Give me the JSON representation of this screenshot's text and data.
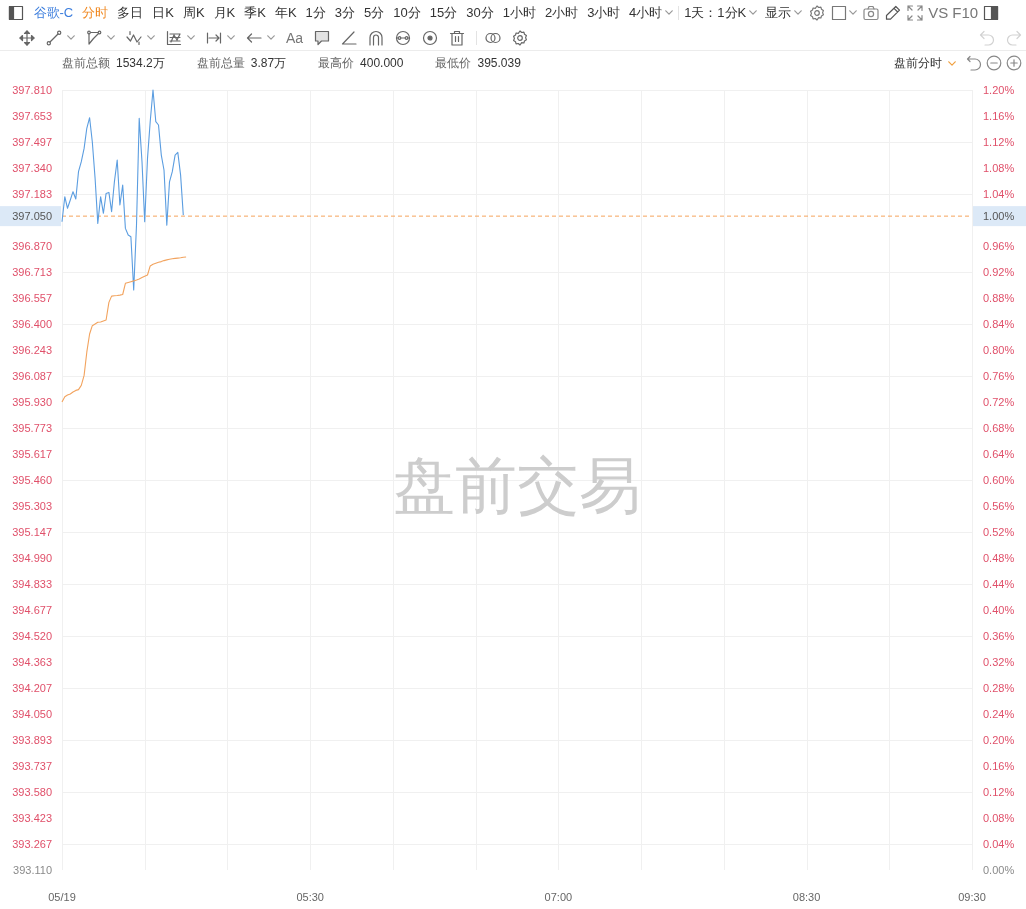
{
  "toolbar": {
    "symbol": "谷歌-C",
    "periods": [
      {
        "label": "分时",
        "selected": true,
        "kind": "tab"
      },
      {
        "label": "多日",
        "selected": false,
        "kind": "tab"
      },
      {
        "label": "日K",
        "selected": false,
        "kind": "tab"
      },
      {
        "label": "周K",
        "selected": false,
        "kind": "tab"
      },
      {
        "label": "月K",
        "selected": false,
        "kind": "tab"
      },
      {
        "label": "季K",
        "selected": false,
        "kind": "tab"
      },
      {
        "label": "年K",
        "selected": false,
        "kind": "tab"
      },
      {
        "label": "1分",
        "selected": false,
        "kind": "tab"
      },
      {
        "label": "3分",
        "selected": false,
        "kind": "tab"
      },
      {
        "label": "5分",
        "selected": false,
        "kind": "tab"
      },
      {
        "label": "10分",
        "selected": false,
        "kind": "tab"
      },
      {
        "label": "15分",
        "selected": false,
        "kind": "tab"
      },
      {
        "label": "30分",
        "selected": false,
        "kind": "tab"
      },
      {
        "label": "1小时",
        "selected": false,
        "kind": "tab"
      },
      {
        "label": "2小时",
        "selected": false,
        "kind": "tab"
      },
      {
        "label": "3小时",
        "selected": false,
        "kind": "tab"
      },
      {
        "label": "4小时",
        "selected": false,
        "kind": "menu"
      }
    ],
    "interval_menu": "1天：1分K",
    "display_menu": "显示",
    "compare": "VS",
    "f10": "F10"
  },
  "drawing_tools": {
    "text_tool": "Aa",
    "undo": {
      "disabled": true
    },
    "redo": {
      "disabled": true
    }
  },
  "stats": [
    {
      "label": "盘前总额",
      "value": "1534.2万"
    },
    {
      "label": "盘前总量",
      "value": "3.87万"
    },
    {
      "label": "最高价",
      "value": "400.000"
    },
    {
      "label": "最低价",
      "value": "395.039"
    }
  ],
  "chart_mode_menu": "盘前分时",
  "chart": {
    "session_label": "盘前交易",
    "chart_data": {
      "type": "line",
      "categories": [
        "05/19",
        null,
        null,
        null,
        null,
        null,
        null,
        null,
        null,
        null,
        null,
        null,
        null,
        null,
        null,
        null,
        null,
        null,
        null,
        null,
        null,
        null,
        null,
        null,
        null,
        null,
        null,
        null,
        null,
        null,
        null,
        null,
        null,
        null,
        null,
        null,
        null,
        null,
        null,
        null,
        null,
        null,
        null,
        null,
        null,
        null,
        null,
        null,
        null,
        null,
        null,
        null,
        null,
        null,
        null,
        null,
        null,
        null,
        null,
        null,
        null,
        null,
        null,
        null,
        null,
        null,
        null,
        null,
        null,
        null,
        null,
        null,
        null,
        null,
        null,
        null,
        null,
        null,
        null,
        null,
        null,
        null,
        null,
        null,
        null,
        null,
        null,
        null,
        null,
        null,
        "05:30",
        null,
        null,
        null,
        null,
        null,
        null,
        null,
        null,
        null,
        null,
        null,
        null,
        null,
        null,
        null,
        null,
        null,
        null,
        null,
        null,
        null,
        null,
        null,
        null,
        null,
        null,
        null,
        null,
        null,
        null,
        null,
        null,
        null,
        null,
        null,
        null,
        null,
        null,
        null,
        null,
        null,
        null,
        null,
        null,
        null,
        null,
        null,
        null,
        null,
        null,
        null,
        null,
        null,
        null,
        null,
        null,
        null,
        null,
        null,
        null,
        null,
        null,
        null,
        null,
        null,
        null,
        null,
        null,
        null,
        null,
        null,
        null,
        null,
        null,
        null,
        null,
        null,
        null,
        null,
        null,
        null,
        null,
        null,
        null,
        null,
        null,
        null,
        null,
        null,
        "07:00",
        null,
        null,
        null,
        null,
        null,
        null,
        null,
        null,
        null,
        null,
        null,
        null,
        null,
        null,
        null,
        null,
        null,
        null,
        null,
        null,
        null,
        null,
        null,
        null,
        null,
        null,
        null,
        null,
        null,
        null,
        null,
        null,
        null,
        null,
        null,
        null,
        null,
        null,
        null,
        null,
        null,
        null,
        null,
        null,
        null,
        null,
        null,
        null,
        null,
        null,
        null,
        null,
        null,
        null,
        null,
        null,
        null,
        null,
        null,
        null,
        null,
        null,
        null,
        null,
        null,
        null,
        null,
        null,
        null,
        null,
        null,
        null,
        null,
        null,
        null,
        null,
        null,
        null,
        null,
        null,
        null,
        null,
        null,
        null,
        null,
        null,
        null,
        null,
        null,
        "08:30",
        null,
        null,
        null,
        null,
        null,
        null,
        null,
        null,
        null,
        null,
        null,
        null,
        null,
        null,
        null,
        null,
        null,
        null,
        null,
        null,
        null,
        null,
        null,
        null,
        null,
        null,
        null,
        null,
        null,
        null,
        null,
        null,
        null,
        null,
        null,
        null,
        null,
        null,
        null,
        null,
        null,
        null,
        null,
        null,
        null,
        null,
        null,
        null,
        null,
        null,
        null,
        null,
        null,
        null,
        null,
        null,
        null,
        null,
        null,
        "09:30"
      ],
      "series": [
        {
          "color": "#5b9de0",
          "values": [
            397.016,
            397.167,
            397.097,
            397.147,
            397.197,
            397.153,
            397.318,
            397.378,
            397.458,
            397.579,
            397.643,
            397.498,
            397.277,
            397.006,
            397.167,
            397.067,
            397.187,
            397.193,
            397.077,
            397.257,
            397.388,
            397.117,
            397.237,
            396.976,
            396.936,
            396.926,
            396.605,
            396.996,
            397.639,
            397.378,
            397.016,
            397.398,
            397.619,
            397.81,
            397.619,
            397.599,
            397.418,
            397.328,
            396.996,
            397.257,
            397.318,
            397.418,
            397.434,
            397.297,
            397.056,
            null,
            null,
            null,
            null,
            null,
            null,
            null,
            null,
            null,
            null,
            null,
            null,
            null,
            null,
            null,
            null,
            null,
            null,
            null,
            null,
            null,
            null,
            null,
            null,
            null,
            null,
            null,
            null,
            null,
            null,
            null,
            null,
            null,
            null,
            null,
            null,
            null,
            null,
            null,
            null,
            null,
            null,
            null,
            null,
            null,
            null,
            null,
            null,
            null,
            null,
            null,
            null,
            null,
            null,
            null,
            null,
            null,
            null,
            null,
            null,
            null,
            null,
            null,
            null,
            null,
            null,
            null,
            null,
            null,
            null,
            null,
            null,
            null,
            null,
            null,
            null,
            null,
            null,
            null,
            null,
            null,
            null,
            null,
            null,
            null,
            null,
            null,
            null,
            null,
            null,
            null,
            null,
            null,
            null,
            null,
            null,
            null,
            null,
            null,
            null,
            null,
            null,
            null,
            null,
            null,
            null,
            null,
            null,
            null,
            null,
            null,
            null,
            null,
            null,
            null,
            null,
            null,
            null,
            null,
            null,
            null,
            null,
            null,
            null,
            null,
            null,
            null,
            null,
            null,
            null,
            null,
            null,
            null,
            null,
            null,
            null,
            null,
            null,
            null,
            null,
            null,
            null,
            null,
            null,
            null,
            null,
            null,
            null,
            null,
            null,
            null,
            null,
            null,
            null,
            null,
            null,
            null,
            null,
            null,
            null,
            null,
            null,
            null,
            null,
            null,
            null,
            null,
            null,
            null,
            null,
            null,
            null,
            null,
            null,
            null,
            null,
            null,
            null,
            null,
            null,
            null,
            null,
            null,
            null,
            null,
            null,
            null,
            null,
            null,
            null,
            null,
            null,
            null,
            null,
            null,
            null,
            null,
            null,
            null,
            null,
            null,
            null,
            null,
            null,
            null,
            null,
            null,
            null,
            null,
            null,
            null,
            null,
            null,
            null,
            null,
            null,
            null,
            null,
            null,
            null,
            null,
            null,
            null,
            null,
            null,
            null,
            null,
            null,
            null,
            null,
            null,
            null,
            null,
            null,
            null,
            null,
            null,
            null,
            null,
            null,
            null,
            null,
            null,
            null,
            null,
            null,
            null,
            null,
            null,
            null,
            null,
            null,
            null,
            null,
            null,
            null,
            null,
            null,
            null,
            null,
            null,
            null,
            null,
            null,
            null,
            null,
            null,
            null,
            null,
            null,
            null,
            null,
            null,
            null,
            null,
            null,
            null,
            null,
            null,
            null,
            null,
            null,
            null,
            null,
            null,
            null
          ]
        },
        {
          "color": "#f2a35e",
          "values": [
            395.93,
            395.962,
            395.972,
            395.978,
            395.99,
            396.0,
            396.005,
            396.03,
            396.09,
            396.23,
            396.34,
            396.39,
            396.4,
            396.41,
            396.412,
            396.418,
            396.424,
            396.53,
            396.568,
            396.57,
            396.572,
            396.574,
            396.578,
            396.645,
            396.65,
            396.655,
            396.66,
            396.665,
            396.672,
            396.68,
            396.688,
            396.695,
            396.75,
            396.76,
            396.766,
            396.772,
            396.776,
            396.782,
            396.786,
            396.79,
            396.793,
            396.795,
            396.797,
            396.799,
            396.802,
            396.804,
            null,
            null,
            null,
            null,
            null,
            null,
            null,
            null,
            null,
            null,
            null,
            null,
            null,
            null,
            null,
            null,
            null,
            null,
            null,
            null,
            null,
            null,
            null,
            null,
            null,
            null,
            null,
            null,
            null,
            null,
            null,
            null,
            null,
            null,
            null,
            null,
            null,
            null,
            null,
            null,
            null,
            null,
            null,
            null,
            null,
            null,
            null,
            null,
            null,
            null,
            null,
            null,
            null,
            null,
            null,
            null,
            null,
            null,
            null,
            null,
            null,
            null,
            null,
            null,
            null,
            null,
            null,
            null,
            null,
            null,
            null,
            null,
            null,
            null,
            null,
            null,
            null,
            null,
            null,
            null,
            null,
            null,
            null,
            null,
            null,
            null,
            null,
            null,
            null,
            null,
            null,
            null,
            null,
            null,
            null,
            null,
            null,
            null,
            null,
            null,
            null,
            null,
            null,
            null,
            null,
            null,
            null,
            null,
            null,
            null,
            null,
            null,
            null,
            null,
            null,
            null,
            null,
            null,
            null,
            null,
            null,
            null,
            null,
            null,
            null,
            null,
            null,
            null,
            null,
            null,
            null,
            null,
            null,
            null,
            null,
            null,
            null,
            null,
            null,
            null,
            null,
            null,
            null,
            null,
            null,
            null,
            null,
            null,
            null,
            null,
            null,
            null,
            null,
            null,
            null,
            null,
            null,
            null,
            null,
            null,
            null,
            null,
            null,
            null,
            null,
            null,
            null,
            null,
            null,
            null,
            null,
            null,
            null,
            null,
            null,
            null,
            null,
            null,
            null,
            null,
            null,
            null,
            null,
            null,
            null,
            null,
            null,
            null,
            null,
            null,
            null,
            null,
            null,
            null,
            null,
            null,
            null,
            null,
            null,
            null,
            null,
            null,
            null,
            null,
            null,
            null,
            null,
            null,
            null,
            null,
            null,
            null,
            null,
            null,
            null,
            null,
            null,
            null,
            null,
            null,
            null,
            null,
            null,
            null,
            null,
            null,
            null,
            null,
            null,
            null,
            null,
            null,
            null,
            null,
            null,
            null,
            null,
            null,
            null,
            null,
            null,
            null,
            null,
            null,
            null,
            null,
            null,
            null,
            null,
            null,
            null,
            null,
            null,
            null,
            null,
            null,
            null,
            null,
            null,
            null,
            null,
            null,
            null,
            null,
            null,
            null,
            null,
            null,
            null,
            null,
            null,
            null,
            null,
            null,
            null,
            null,
            null,
            null,
            null,
            null,
            null,
            null,
            null,
            null,
            null
          ]
        }
      ],
      "ylim": [
        393.11,
        397.81
      ],
      "yticks": [
        {
          "value": 397.81,
          "label": "397.810"
        },
        397.653,
        397.497,
        {
          "value": 397.34,
          "label": "397.340"
        },
        397.183,
        {
          "value": 396.87,
          "label": "396.870"
        },
        396.713,
        396.557,
        {
          "value": 396.4,
          "label": "396.400"
        },
        396.243,
        396.087,
        {
          "value": 395.93,
          "label": "395.930"
        },
        395.773,
        395.617,
        {
          "value": 395.46,
          "label": "395.460"
        },
        395.303,
        395.147,
        {
          "value": 394.99,
          "label": "394.990"
        },
        394.833,
        394.677,
        {
          "value": 394.52,
          "label": "394.520"
        },
        394.363,
        394.207,
        {
          "value": 394.05,
          "label": "394.050"
        },
        393.893,
        393.737,
        {
          "value": 393.58,
          "label": "393.580"
        },
        393.423,
        393.267,
        {
          "value": 393.11,
          "label": "393.110"
        }
      ],
      "grid": true,
      "ref_lines": [
        {
          "axis": "y",
          "value": 397.05,
          "label": "397.050",
          "color": "#f5a35c"
        }
      ]
    },
    "percent_axis": {
      "ticks": [
        "1.20%",
        "1.16%",
        "1.12%",
        "1.08%",
        "1.04%",
        "0.96%",
        "0.92%",
        "0.88%",
        "0.84%",
        "0.80%",
        "0.76%",
        "0.72%",
        "0.68%",
        "0.64%",
        "0.60%",
        "0.56%",
        "0.52%",
        "0.48%",
        "0.44%",
        "0.40%",
        "0.36%",
        "0.32%",
        "0.28%",
        "0.24%",
        "0.20%",
        "0.16%",
        "0.12%",
        "0.08%",
        "0.04%",
        "0.00%"
      ],
      "current_label": "1.00%"
    }
  }
}
